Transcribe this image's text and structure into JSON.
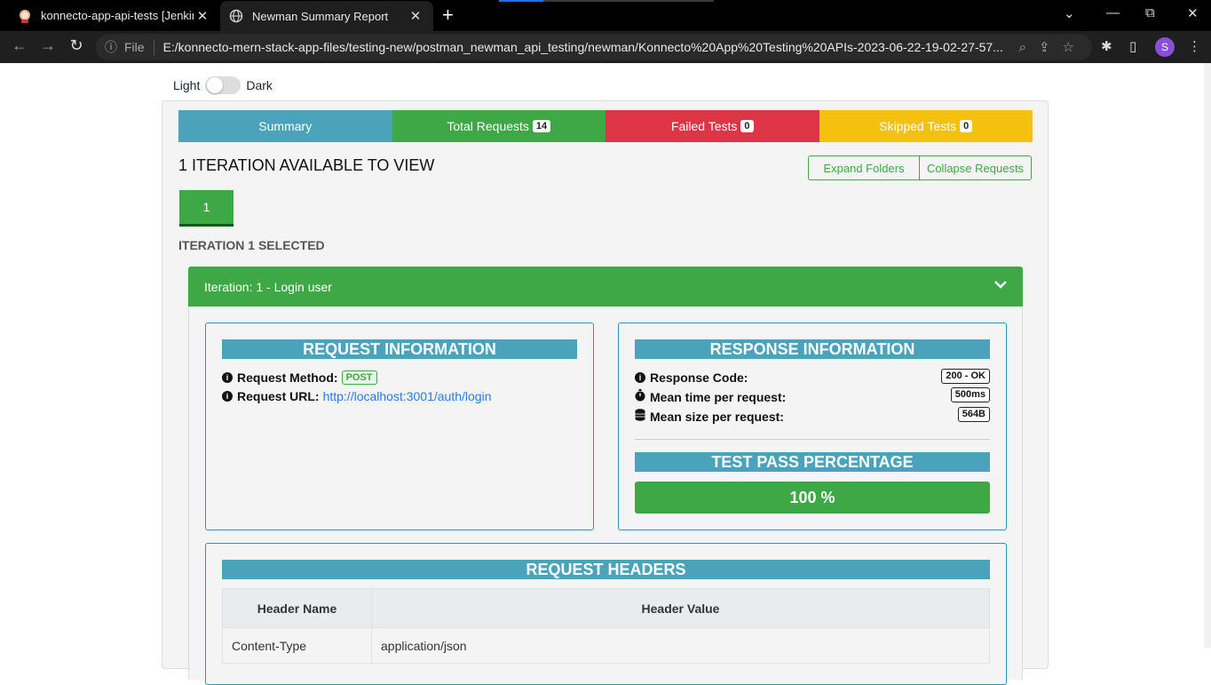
{
  "browser": {
    "tabs": [
      {
        "title": "konnecto-app-api-tests [Jenkins]",
        "close": "✕"
      },
      {
        "title": "Newman Summary Report",
        "close": "✕"
      }
    ],
    "new_tab": "+",
    "window_controls": {
      "minimize": "⌄",
      "restore": "⧉",
      "close": "✕"
    },
    "nav": {
      "back": "←",
      "forward": "→",
      "reload": "↻"
    },
    "omnibox": {
      "info": "ⓘ",
      "scheme_label": "File",
      "url": "E:/konnecto-mern-stack-app-files/testing-new/postman_newman_api_testing/newman/Konnecto%20App%20Testing%20APIs-2023-06-22-19-02-27-57..."
    },
    "omnibox_icons": {
      "zoom": "⌕",
      "share": "⇪",
      "bookmark": "☆"
    },
    "toolbar_icons": {
      "extensions": "✱",
      "sidepanel": "▯",
      "menu": "⋮"
    },
    "profile_initial": "S"
  },
  "theme_toggle": {
    "light_label": "Light",
    "dark_label": "Dark"
  },
  "summary_tabs": [
    {
      "label": "Summary",
      "color": "#4aa3bb",
      "badge": ""
    },
    {
      "label": "Total Requests",
      "color": "#3fa846",
      "badge": "14"
    },
    {
      "label": "Failed Tests",
      "color": "#dd3545",
      "badge": "0"
    },
    {
      "label": "Skipped Tests",
      "color": "#f5c10f",
      "badge": "0"
    }
  ],
  "iterations": {
    "available_title": "1 ITERATION AVAILABLE TO VIEW",
    "expand_label": "Expand Folders",
    "collapse_label": "Collapse Requests",
    "pill_label": "1",
    "selected_label": "ITERATION 1 SELECTED"
  },
  "accordion": {
    "title": "Iteration: 1 - Login user",
    "chevron": "⌄"
  },
  "request_info": {
    "title": "REQUEST INFORMATION",
    "method_label": "Request Method:",
    "method_value": "POST",
    "url_label": "Request URL:",
    "url_value": "http://localhost:3001/auth/login"
  },
  "response_info": {
    "title": "RESPONSE INFORMATION",
    "code_label": "Response Code:",
    "code_value": "200 - OK",
    "time_label": "Mean time per request:",
    "time_value": "500ms",
    "size_label": "Mean size per request:",
    "size_value": "564B",
    "pass_title": "TEST PASS PERCENTAGE",
    "pass_value": "100 %"
  },
  "request_headers": {
    "title": "REQUEST HEADERS",
    "columns": [
      "Header Name",
      "Header Value"
    ],
    "rows": [
      [
        "Content-Type",
        "application/json"
      ]
    ]
  },
  "colors": {
    "accent_blue": "#4aa3bb",
    "success": "#3fa846",
    "danger": "#dd3545",
    "warning": "#f5c10f"
  }
}
